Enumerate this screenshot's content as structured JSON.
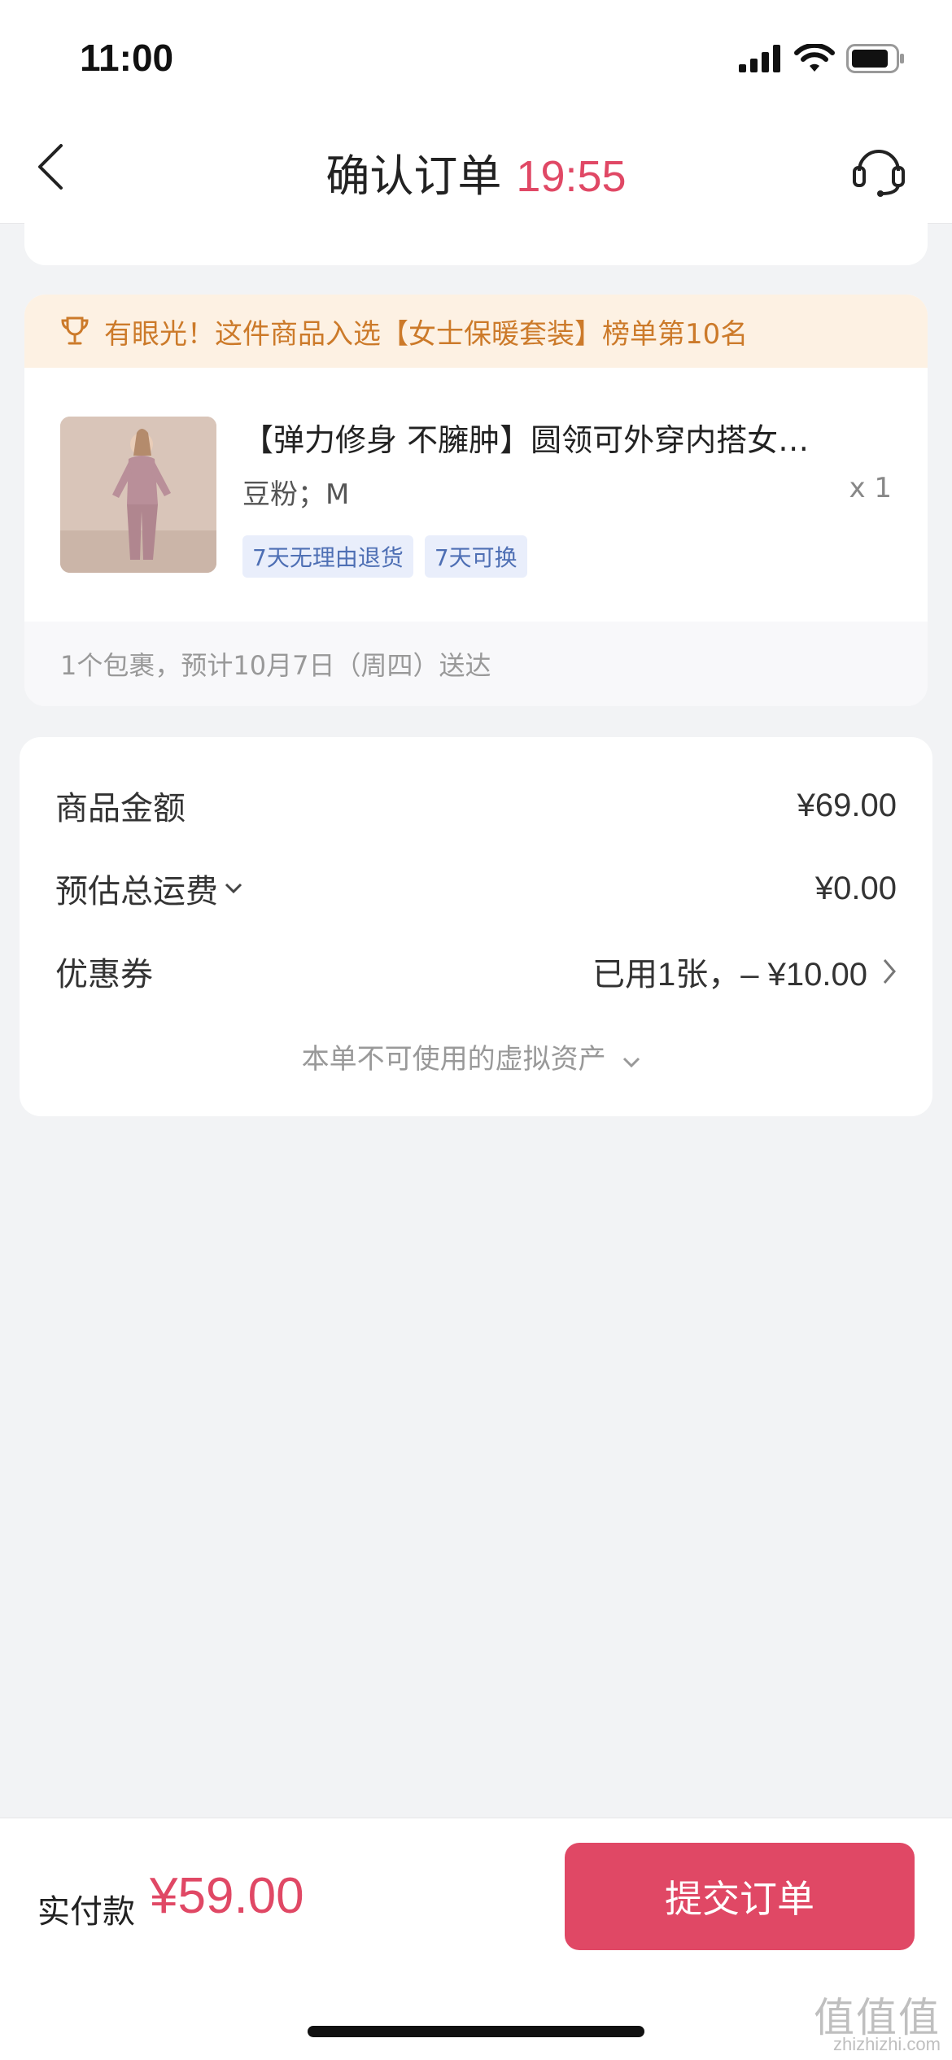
{
  "status_bar": {
    "time": "11:00"
  },
  "nav": {
    "title": "确认订单",
    "countdown": "19:55"
  },
  "rank_banner": {
    "text": "有眼光！这件商品入选【女士保暖套装】榜单第10名"
  },
  "product": {
    "title": "【弹力修身 不臃肿】圆领可外穿内搭女…",
    "spec": "豆粉；M",
    "qty": "x 1",
    "tags": [
      "7天无理由退货",
      "7天可换"
    ]
  },
  "delivery": {
    "text": "1个包裹，预计10月7日（周四）送达"
  },
  "summary": {
    "goods_label": "商品金额",
    "goods_value": "¥69.00",
    "shipping_label": "预估总运费",
    "shipping_value": "¥0.00",
    "coupon_label": "优惠券",
    "coupon_value": "已用1张，– ¥10.00",
    "virtual_assets": "本单不可使用的虚拟资产"
  },
  "footer": {
    "pay_label": "实付款",
    "pay_amount": "¥59.00",
    "submit_label": "提交订单"
  },
  "watermark": {
    "logo": "值值值",
    "site": "zhizhizhi.com"
  },
  "icons": [
    "signal-icon",
    "wifi-icon",
    "battery-icon",
    "back-icon",
    "customer-service-icon",
    "trophy-icon",
    "chevron-down-icon",
    "chevron-right-icon"
  ],
  "colors": {
    "accent": "#e04865",
    "rank_text": "#cc7a2a",
    "rank_bg": "#fdf1e3",
    "tag_text": "#4e6fb4",
    "tag_bg": "#e9eefb"
  }
}
